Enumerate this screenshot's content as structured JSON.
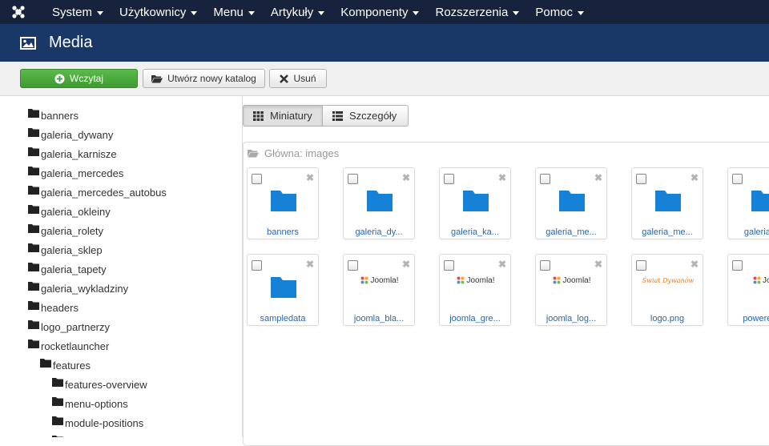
{
  "topnav": {
    "logo_icon": "joomla-icon",
    "items": [
      "System",
      "Użytkownicy",
      "Menu",
      "Artykuły",
      "Komponenty",
      "Rozszerzenia",
      "Pomoc"
    ]
  },
  "header": {
    "icon": "image-icon",
    "title": "Media"
  },
  "toolbar": {
    "upload_label": "Wczytaj",
    "newdir_label": "Utwórz nowy katalog",
    "delete_label": "Usuń"
  },
  "tree": [
    "banners",
    "galeria_dywany",
    "galeria_karnisze",
    "galeria_mercedes",
    "galeria_mercedes_autobus",
    "galeria_okleiny",
    "galeria_rolety",
    "galeria_sklep",
    "galeria_tapety",
    "galeria_wykladziny",
    "headers",
    "logo_partnerzy",
    "rocketlauncher",
    "features",
    "features-overview",
    "menu-options",
    "module-positions"
  ],
  "view": {
    "thumbs_label": "Miniatury",
    "details_label": "Szczegóły",
    "active": "thumbs"
  },
  "breadcrumb": "Główna: images",
  "items": [
    {
      "label": "banners",
      "type": "folder"
    },
    {
      "label": "galeria_dy...",
      "type": "folder"
    },
    {
      "label": "galeria_ka...",
      "type": "folder"
    },
    {
      "label": "galeria_me...",
      "type": "folder"
    },
    {
      "label": "galeria_me...",
      "type": "folder"
    },
    {
      "label": "galeria_...",
      "type": "folder"
    },
    {
      "label": "sampledata",
      "type": "folder"
    },
    {
      "label": "joomla_bla...",
      "type": "image",
      "text": "Joomla!"
    },
    {
      "label": "joomla_gre...",
      "type": "image",
      "text": "Joomla!"
    },
    {
      "label": "joomla_log...",
      "type": "image",
      "text": "Joomla!"
    },
    {
      "label": "logo.png",
      "type": "image",
      "text": "Świat Dywanów"
    },
    {
      "label": "powered...",
      "type": "image",
      "text": "Joo"
    }
  ],
  "colors": {
    "topnav_bg": "#17233c",
    "header_bg": "#1a3867",
    "upload_btn": "#46a546",
    "folder_blue": "#1582d8",
    "link_blue": "#2a67a8"
  }
}
